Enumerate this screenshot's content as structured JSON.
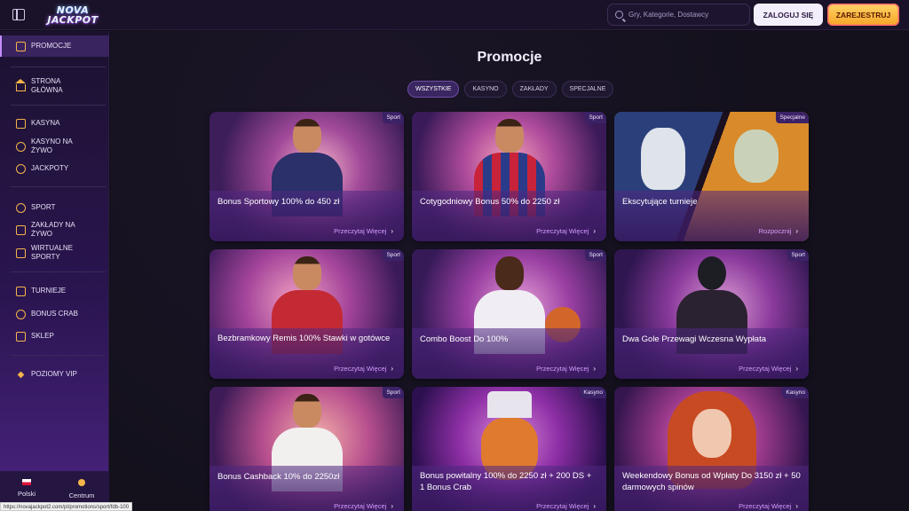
{
  "header": {
    "logo_line1": "NOVA",
    "logo_line2": "JACKPOT",
    "search_placeholder": "Gry, Kategorie, Dostawcy",
    "login_label": "ZALOGUJ SIĘ",
    "register_label": "ZAREJESTRUJ"
  },
  "sidebar": {
    "items": [
      {
        "label": "PROMOCJE",
        "icon": "promotions-icon"
      },
      {
        "label": "STRONA GŁÓWNA",
        "icon": "home-icon"
      },
      {
        "label": "KASYNA",
        "icon": "casino-icon"
      },
      {
        "label": "KASYNO NA ŻYWO",
        "icon": "live-casino-icon"
      },
      {
        "label": "JACKPOTY",
        "icon": "jackpot-icon"
      },
      {
        "label": "SPORT",
        "icon": "sport-ball-icon"
      },
      {
        "label": "ZAKŁADY NA ŻYWO",
        "icon": "live-bets-icon"
      },
      {
        "label": "WIRTUALNE SPORTY",
        "icon": "virtual-sports-icon"
      },
      {
        "label": "TURNIEJE",
        "icon": "trophy-icon"
      },
      {
        "label": "BONUS CRAB",
        "icon": "bonus-crab-icon"
      },
      {
        "label": "SKLEP",
        "icon": "shop-icon"
      },
      {
        "label": "POZIOMY VIP",
        "icon": "vip-diamond-icon"
      }
    ],
    "footer": {
      "language": "Polski",
      "center": "Centrum"
    }
  },
  "main": {
    "title": "Promocje",
    "tabs": [
      "WSZYSTKIE",
      "KASYNO",
      "ZAKŁADY",
      "SPECJALNE"
    ],
    "cards": [
      {
        "title": "Bonus Sportowy 100% do 450 zł",
        "badge": "Sport",
        "cta": "Przeczytaj Więcej"
      },
      {
        "title": "Cotygodniowy Bonus 50% do 2250 zł",
        "badge": "Sport",
        "cta": "Przeczytaj Więcej"
      },
      {
        "title": "Ekscytujące turnieje",
        "badge": "Specjalne",
        "cta": "Rozpocznij"
      },
      {
        "title": "Bezbramkowy Remis 100% Stawki w gotówce",
        "badge": "Sport",
        "cta": "Przeczytaj Więcej"
      },
      {
        "title": "Combo Boost Do 100%",
        "badge": "Sport",
        "cta": "Przeczytaj Więcej"
      },
      {
        "title": "Dwa Gole Przewagi Wczesna Wypłata",
        "badge": "Sport",
        "cta": "Przeczytaj Więcej"
      },
      {
        "title": "Bonus Cashback 10% do 2250zł",
        "badge": "Sport",
        "cta": "Przeczytaj Więcej"
      },
      {
        "title": "Bonus powitalny 100% do 2250 zł + 200 DS + 1 Bonus Crab",
        "badge": "Kasyno",
        "cta": "Przeczytaj Więcej"
      },
      {
        "title": "Weekendowy Bonus od Wpłaty Do 3150 zł + 50 darmowych spinów",
        "badge": "Kasyno",
        "cta": "Przeczytaj Więcej"
      }
    ]
  },
  "status_url": "https://novajackpot2.com/pl/promotions/sport/fdb-100",
  "colors": {
    "accent_purple": "#d49cff",
    "register_gold": "#f5a524",
    "background": "#14111d"
  }
}
